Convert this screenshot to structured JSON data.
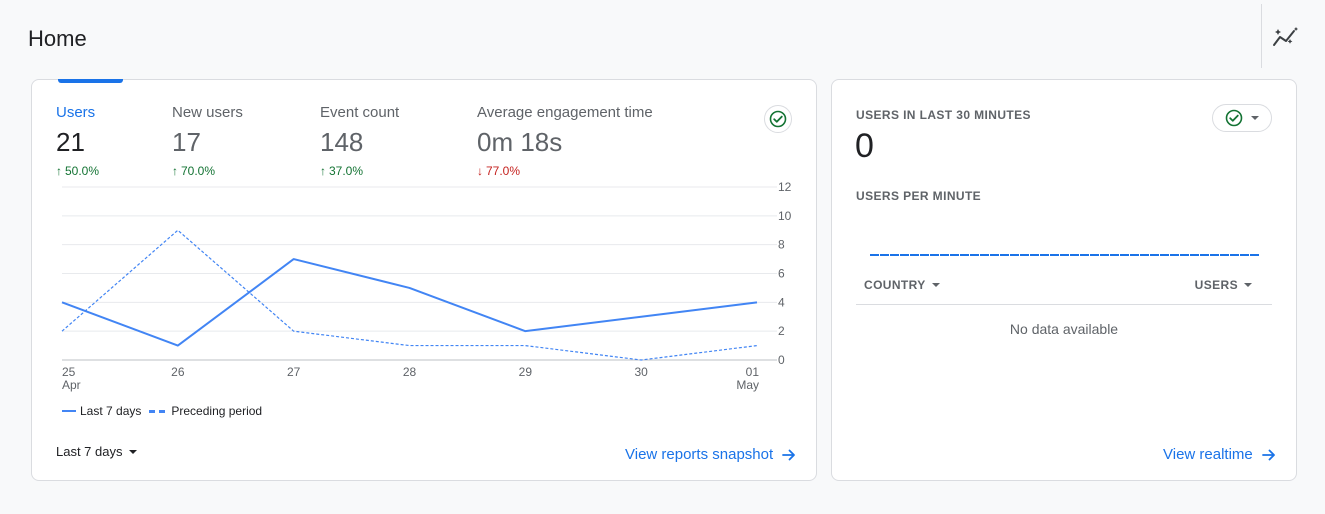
{
  "page": {
    "title": "Home",
    "insights_icon": "auto-graph-icon"
  },
  "overview": {
    "metrics": [
      {
        "label": "Users",
        "value": "21",
        "delta": "50.0%",
        "direction": "up"
      },
      {
        "label": "New users",
        "value": "17",
        "delta": "70.0%",
        "direction": "up"
      },
      {
        "label": "Event count",
        "value": "148",
        "delta": "37.0%",
        "direction": "up"
      },
      {
        "label": "Average engagement time",
        "value": "0m 18s",
        "delta": "77.0%",
        "direction": "down"
      }
    ],
    "status_icon": "check-circle-icon",
    "legend": {
      "current": "Last 7 days",
      "previous": "Preceding period"
    },
    "period_select": "Last 7 days",
    "snapshot_link": "View reports snapshot"
  },
  "chart_data": {
    "type": "line",
    "x": [
      "25",
      "26",
      "27",
      "28",
      "29",
      "30",
      "01"
    ],
    "x_sublabels": [
      "Apr",
      "",
      "",
      "",
      "",
      "",
      "May"
    ],
    "series": [
      {
        "name": "Last 7 days",
        "values": [
          4,
          1,
          7,
          5,
          2,
          3,
          4
        ],
        "style": "solid",
        "color": "#4285f4"
      },
      {
        "name": "Preceding period",
        "values": [
          2,
          9,
          2,
          1,
          1,
          0,
          1
        ],
        "style": "dashed",
        "color": "#4285f4"
      }
    ],
    "y_ticks": [
      "12",
      "10",
      "8",
      "6",
      "4",
      "2",
      "0"
    ],
    "ylim": [
      0,
      12
    ],
    "y_axis_side": "right",
    "grid": true
  },
  "realtime": {
    "title": "USERS IN LAST 30 MINUTES",
    "value": "0",
    "subtitle": "USERS PER MINUTE",
    "col_country": "COUNTRY",
    "col_users": "USERS",
    "empty_text": "No data available",
    "link": "View realtime"
  },
  "colors": {
    "accent": "#1a73e8",
    "up": "#137333",
    "down": "#c5221f",
    "line": "#4285f4"
  }
}
